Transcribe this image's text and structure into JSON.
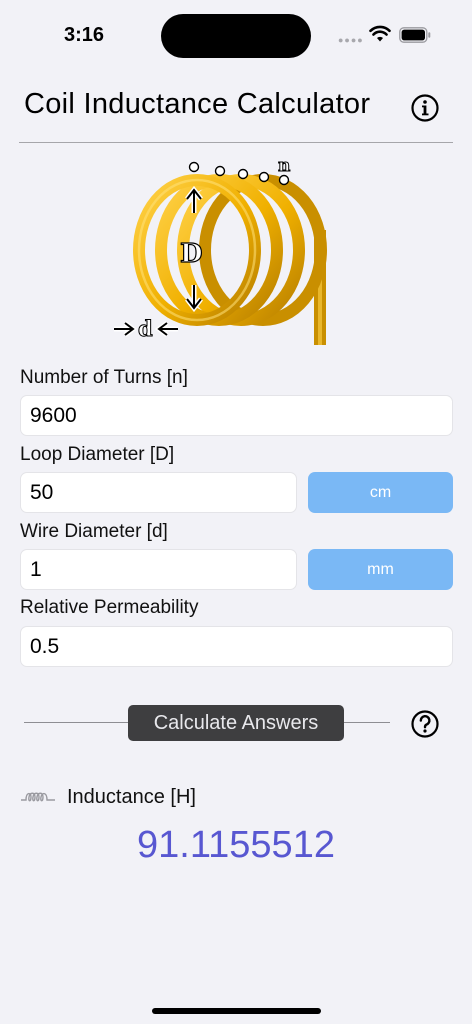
{
  "status_bar": {
    "time": "3:16",
    "signal_icon": "cellular-dots-icon",
    "wifi_icon": "wifi-icon",
    "battery_icon": "battery-icon"
  },
  "header": {
    "title": "Coil Inductance Calculator",
    "info_icon": "info-circle-icon"
  },
  "diagram": {
    "label_n": "n",
    "label_D": "D",
    "label_d": "d",
    "coil_color": "#f0b400"
  },
  "fields": [
    {
      "label": "Number of Turns [n]",
      "value": "9600"
    },
    {
      "label": "Loop Diameter [D]",
      "value": "50",
      "unit": "cm"
    },
    {
      "label": "Wire Diameter [d]",
      "value": "1",
      "unit": "mm"
    },
    {
      "label": "Relative Permeability",
      "value": "0.5"
    }
  ],
  "calculate": {
    "label": "Calculate Answers",
    "help_icon": "question-circle-icon"
  },
  "result": {
    "icon": "coil-icon",
    "label": "Inductance [H]",
    "value": "91.1155512"
  },
  "colors": {
    "accent_unit_button": "#7ab8f5",
    "result_value": "#5857d1",
    "calc_button": "#3e3e40"
  }
}
